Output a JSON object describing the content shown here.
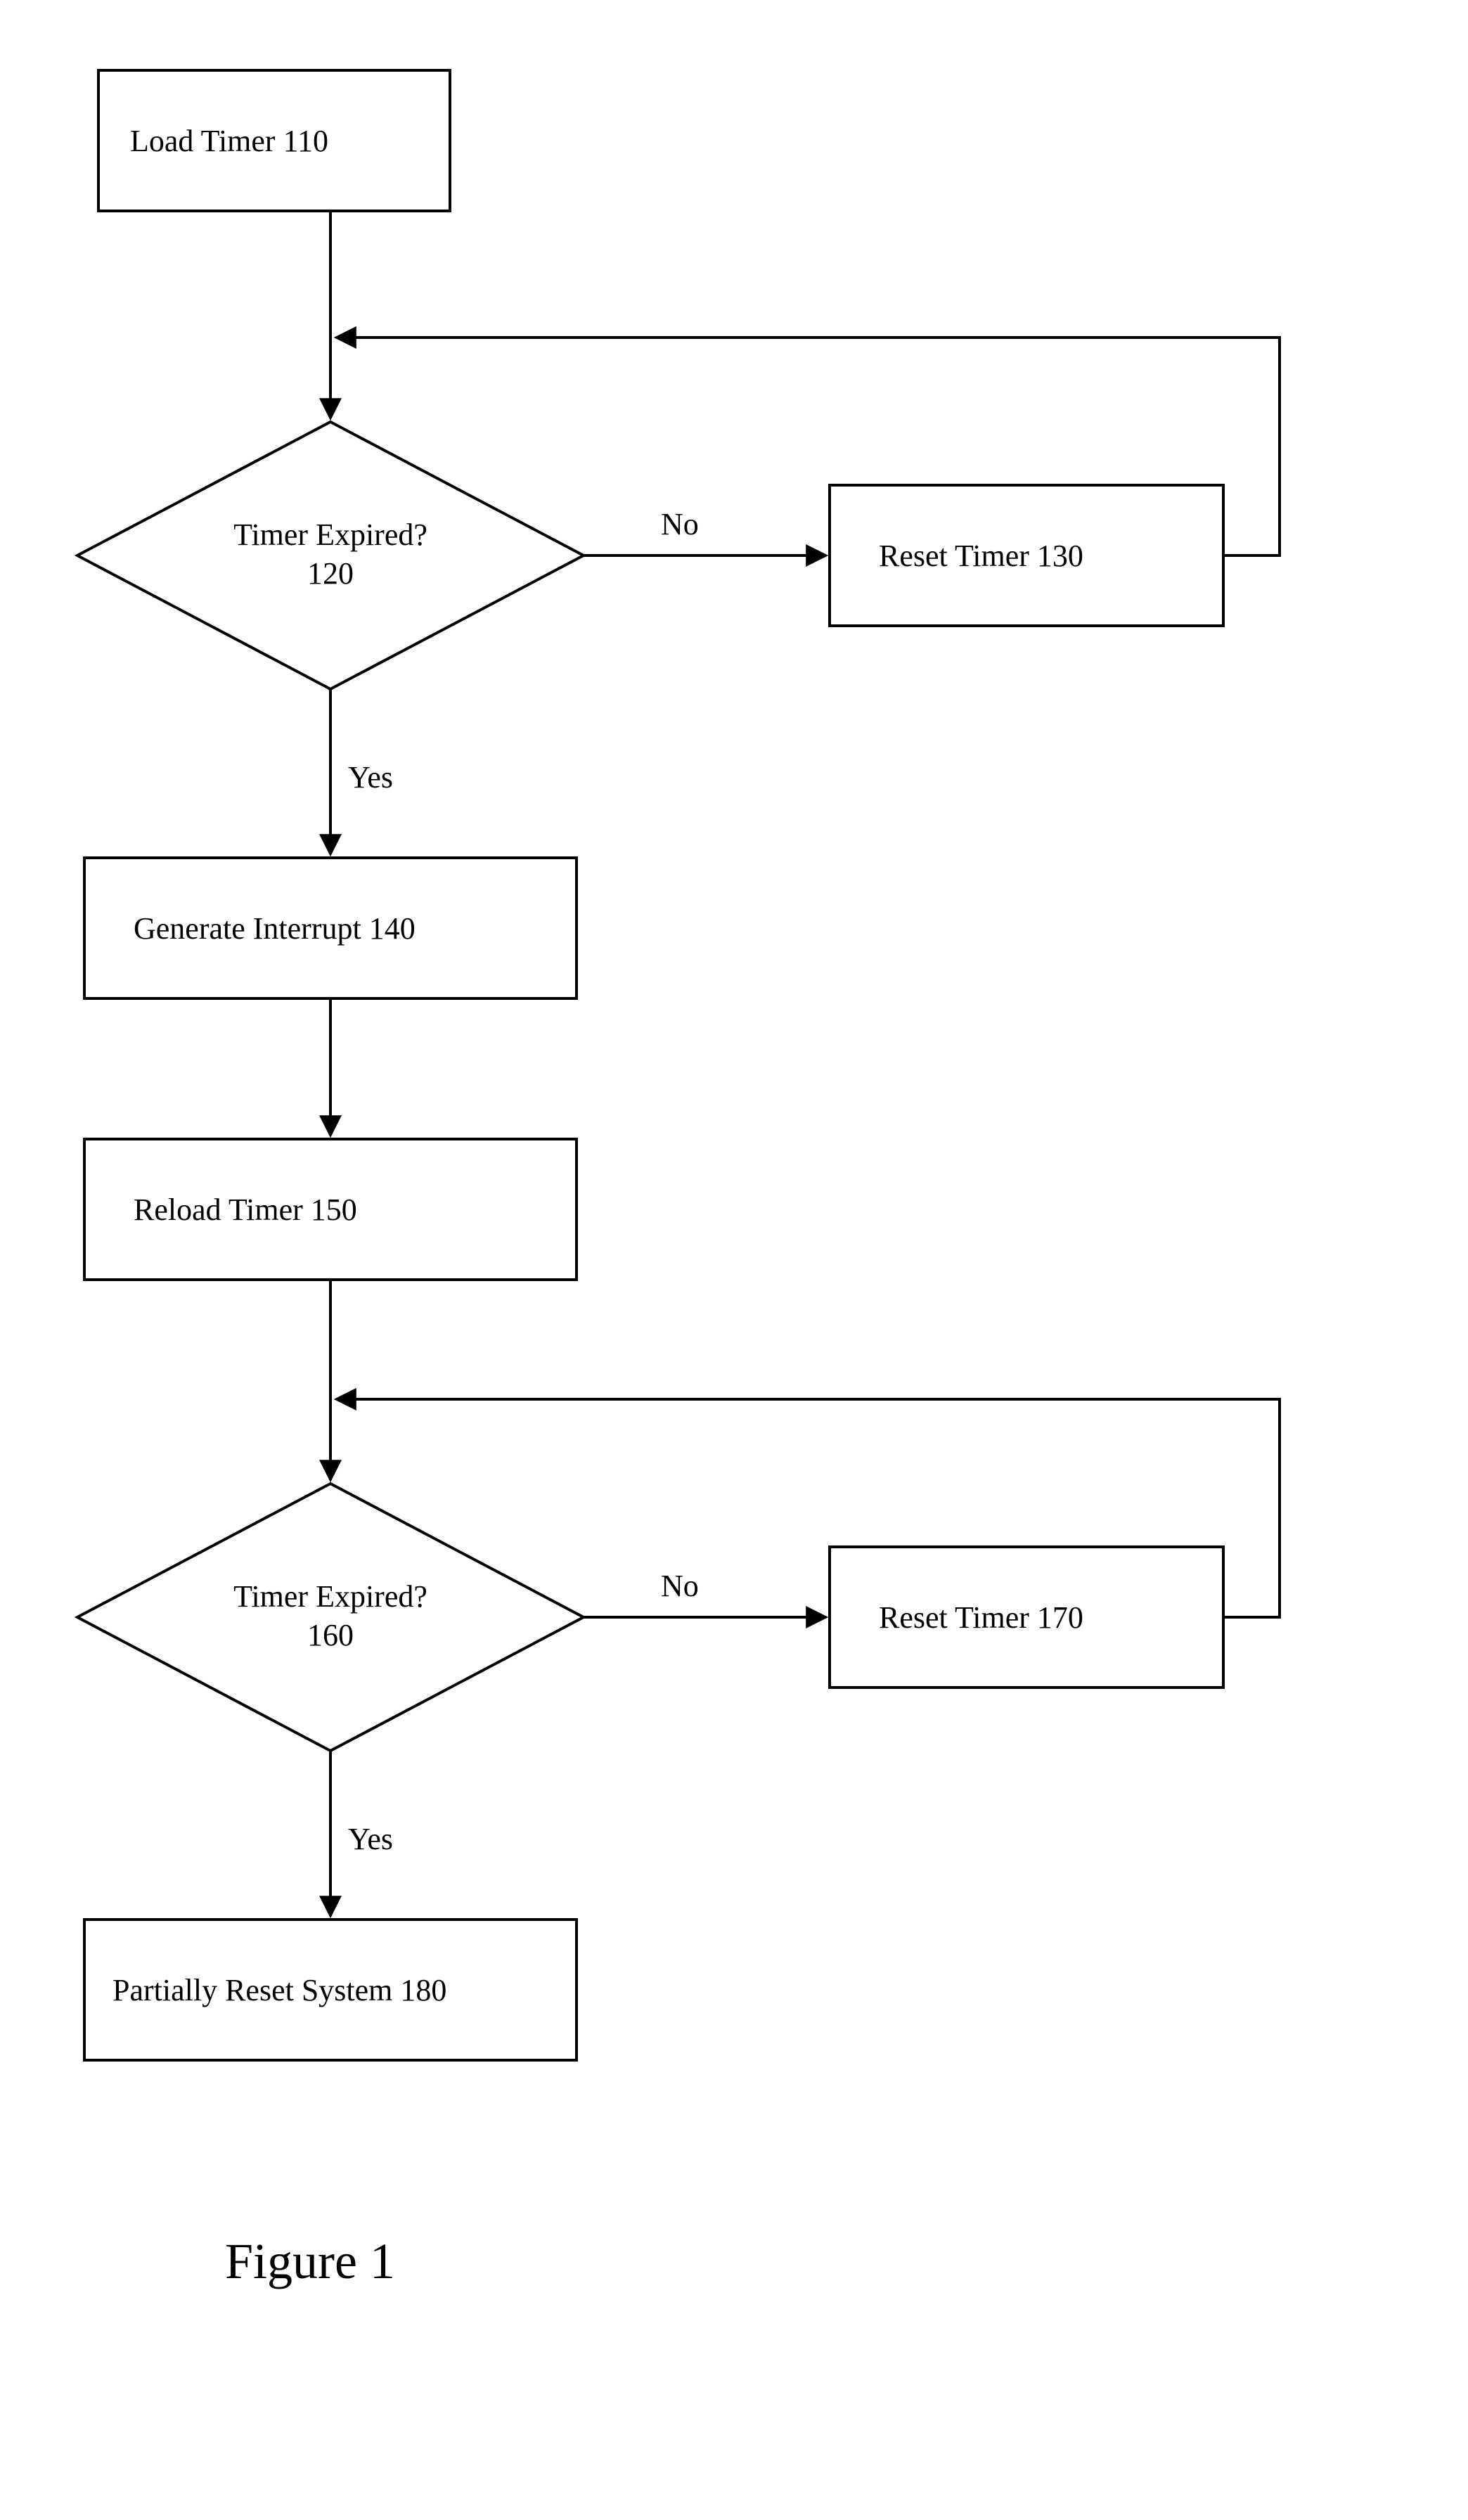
{
  "figure": {
    "caption": "Figure 1",
    "nodes": {
      "n110": {
        "label": "Load Timer",
        "ref": "110"
      },
      "n120": {
        "label": "Timer Expired?",
        "ref": "120"
      },
      "n130": {
        "label": "Reset Timer",
        "ref": "130"
      },
      "n140": {
        "label": "Generate Interrupt",
        "ref": "140"
      },
      "n150": {
        "label": "Reload Timer",
        "ref": "150"
      },
      "n160": {
        "label": "Timer Expired?",
        "ref": "160"
      },
      "n170": {
        "label": "Reset Timer",
        "ref": "170"
      },
      "n180": {
        "label": "Partially Reset System",
        "ref": "180"
      }
    },
    "edges": {
      "e120_no": "No",
      "e120_yes": "Yes",
      "e160_no": "No",
      "e160_yes": "Yes"
    }
  }
}
